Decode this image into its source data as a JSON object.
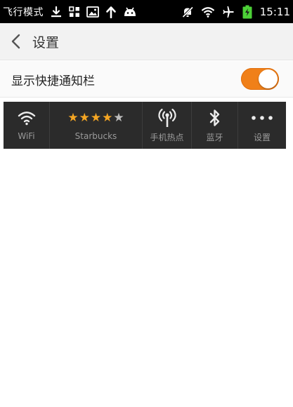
{
  "status_bar": {
    "mode_label": "飞行模式",
    "time": "15:11",
    "icons_left": [
      "download-icon",
      "apps-grid-icon",
      "image-icon",
      "upload-arrow-icon",
      "android-icon"
    ],
    "icons_right": [
      "bell-off-icon",
      "wifi-icon",
      "airplane-icon",
      "battery-charging-icon"
    ]
  },
  "header": {
    "title": "设置",
    "back_icon": "chevron-left-icon"
  },
  "setting": {
    "label": "显示快捷通知栏",
    "enabled": true,
    "toggle_color": "#f08019"
  },
  "shortcuts": {
    "items": [
      {
        "label": "WiFi",
        "icon": "wifi-icon"
      },
      {
        "label": "Starbucks",
        "icon": "stars-rating",
        "rating": 4,
        "max_rating": 5
      },
      {
        "label": "手机热点",
        "icon": "hotspot-icon"
      },
      {
        "label": "蓝牙",
        "icon": "bluetooth-icon"
      },
      {
        "label": "设置",
        "icon": "more-dots-icon"
      }
    ],
    "star_color": "#f5a623",
    "star_empty_color": "#bdbdbd"
  }
}
